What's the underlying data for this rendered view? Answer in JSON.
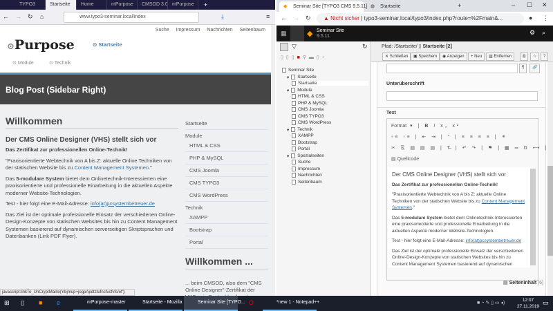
{
  "firefox": {
    "tabs": [
      "TYPO3",
      "Startseite",
      "Home",
      "mPurpose",
      "CMSOD 3.0",
      "mPurpose"
    ],
    "url": "www.typo3-seminar.local/index",
    "top_nav": [
      "Suche",
      "Impressum",
      "Nachrichten",
      "Seitenbaum"
    ],
    "logo": "Purpose",
    "breadcrumb": "Startseite",
    "menu": [
      "Module",
      "Technik"
    ],
    "banner_title": "Blog Post (Sidebar Right)",
    "heading": "Willkommen",
    "subheading": "Der CMS Online Designer (VHS) stellt sich vor",
    "bold_line": "Das Zertifikat zur professionellen Online-Technik!",
    "p1_a": "\"Praxisorientierte Webtechnik von A bis Z: aktuelle Online Techniken von der statischen Website bis zu ",
    "p1_link": "Content Management Systemen",
    "p1_b": ".\"",
    "p2_a": "Das ",
    "p2_bold": "5-modulare System",
    "p2_b": " bietet dem Onlinetechnik-Interessierten eine praxisorientierte und professionelle Einarbeitung in die aktuellen Aspekte moderner Website-Technologien.",
    "p3_a": "Test - hier folgt eine E-Mail-Adresse: ",
    "p3_link": "info(at)pcsystembetreuer.de",
    "p4": "Das Ziel ist der optimale professionelle Einsatz der verschiedenen Online-Design-Konzepte von statischen Websites bis hin zu Content Management Systemen basierend auf dynamischen serverseitigen Skriptsprachen und Datenbanken (Link PDF Flyer).",
    "sidebar": [
      "Startseite",
      "Module",
      "HTML & CSS",
      "PHP & MySQL",
      "CMS Joomla",
      "CMS TYPO3",
      "CMS WordPress",
      "Technik",
      "XAMPP",
      "Bootstrap",
      "Portal"
    ],
    "sidebar_heading": "Willkommen ...",
    "sidebar_text": "... beim CMSOD, also dem \"CMS Online Designer\"-Zertifikat der VHSen in Deutschland und",
    "status": "javascript:linkTo_UnCryptMailto('nbjmup+jogpApdtztufncfusfvfs/ef');"
  },
  "chrome": {
    "tabs": [
      "Seminar Site [TYPO3 CMS 9.5.11]",
      "Startseite"
    ],
    "not_secure": "Nicht sicher",
    "url": "typo3-seminar.local/typo3/index.php?route=%2Fmain&...",
    "site_name": "Seminar Site",
    "version": "9.5.11",
    "path_label": "Pfad: /Startseite/",
    "page_title": "Startseite [2]",
    "buttons": [
      "Schließen",
      "Speichern",
      "Anzeigen",
      "Neu",
      "Entfernen"
    ],
    "tree": [
      {
        "label": "Seminar Site",
        "level": 0
      },
      {
        "label": "Startseite",
        "level": 1
      },
      {
        "label": "Startseite",
        "level": 2
      },
      {
        "label": "Module",
        "level": 1
      },
      {
        "label": "HTML & CSS",
        "level": 2
      },
      {
        "label": "PHP & MySQL",
        "level": 2
      },
      {
        "label": "CMS Joomla",
        "level": 2
      },
      {
        "label": "CMS TYPO3",
        "level": 2
      },
      {
        "label": "CMS WordPress",
        "level": 2
      },
      {
        "label": "Technik",
        "level": 1
      },
      {
        "label": "XAMPP",
        "level": 2
      },
      {
        "label": "Bootstrap",
        "level": 2
      },
      {
        "label": "Portal",
        "level": 2
      },
      {
        "label": "Spezialseiten",
        "level": 1
      },
      {
        "label": "Suche",
        "level": 2
      },
      {
        "label": "Impressum",
        "level": 2
      },
      {
        "label": "Nachrichten",
        "level": 2
      },
      {
        "label": "Seitenbaum",
        "level": 2
      }
    ],
    "label_subheader": "Unterüberschrift",
    "label_text": "Text",
    "format_label": "Format",
    "source_label": "Quellcode",
    "rte_heading": "Der CMS Online Designer (VHS) stellt sich vor",
    "footer_label": "Seiteninhalt",
    "footer_count": "[6]"
  },
  "taskbar": {
    "items": [
      "mPurpose-master",
      "Startseite - Mozilla ...",
      "Seminar Site [TYPO...",
      "*new 1 - Notepad++"
    ],
    "time": "12:07",
    "date": "27.11.2019"
  }
}
